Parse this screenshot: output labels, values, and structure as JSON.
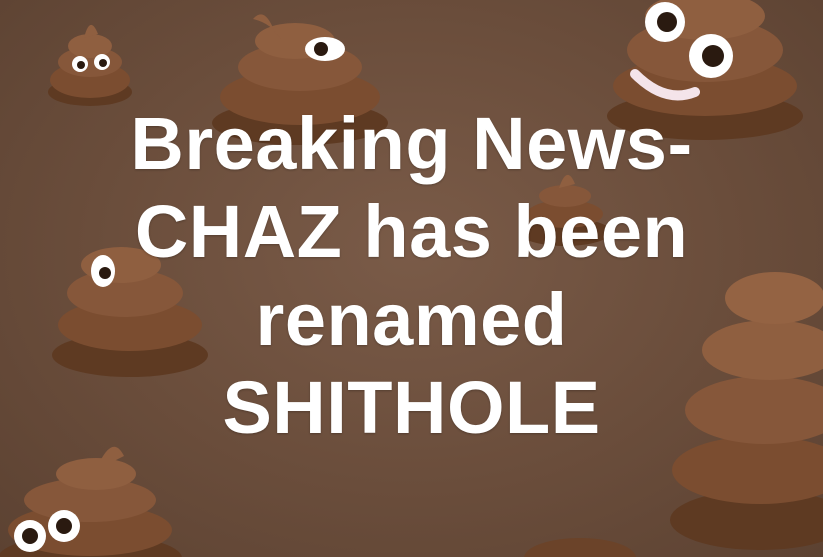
{
  "meme": {
    "caption_lines": [
      "Breaking News-",
      "CHAZ has been",
      "renamed",
      "SHITHOLE"
    ],
    "background_icon": "pile-of-poo-emoji",
    "colors": {
      "background": "#6b4e3d",
      "text": "#ffffff",
      "poop_body": "#8a5a3c"
    }
  }
}
